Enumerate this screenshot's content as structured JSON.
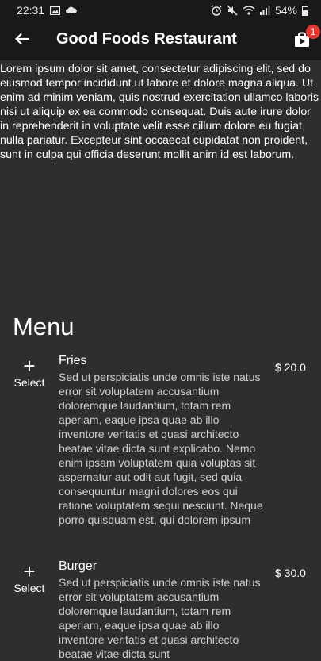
{
  "status_bar": {
    "time": "22:31",
    "battery": "54%",
    "icons": [
      "gallery-icon",
      "cloud-icon",
      "alarm-icon",
      "mute-icon",
      "wifi-icon",
      "signal-icon",
      "battery-icon"
    ]
  },
  "app_bar": {
    "title": "Good Foods Restaurant",
    "cart_badge": "1"
  },
  "restaurant": {
    "description": "Lorem ipsum dolor sit amet, consectetur adipiscing elit, sed do eiusmod tempor incididunt ut labore et dolore magna aliqua. Ut enim ad minim veniam, quis nostrud exercitation ullamco laboris nisi ut aliquip ex ea commodo consequat. Duis aute irure dolor in reprehenderit in voluptate velit esse cillum dolore eu fugiat nulla pariatur. Excepteur sint occaecat cupidatat non proident, sunt in culpa qui officia deserunt mollit anim id est laborum."
  },
  "menu": {
    "heading": "Menu",
    "items": [
      {
        "select_label": "Select",
        "name": "Fries",
        "description": "Sed ut perspiciatis unde omnis iste natus error sit voluptatem accusantium doloremque laudantium, totam rem aperiam, eaque ipsa quae ab illo inventore veritatis et quasi architecto beatae vitae dicta sunt explicabo. Nemo enim ipsam voluptatem quia voluptas sit aspernatur aut odit aut fugit, sed quia consequuntur magni dolores eos qui ratione voluptatem sequi nesciunt. Neque porro quisquam est, qui dolorem ipsum",
        "price": "$ 20.0"
      },
      {
        "select_label": "Select",
        "name": "Burger",
        "description": "Sed ut perspiciatis unde omnis iste natus error sit voluptatem accusantium doloremque laudantium, totam rem aperiam, eaque ipsa quae ab illo inventore veritatis et quasi architecto beatae vitae dicta sunt",
        "price": "$ 30.0"
      }
    ]
  },
  "colors": {
    "background": "#2e2e2e",
    "app_bar": "#191919",
    "badge": "#e53935",
    "description_text": "#cfcfcf"
  }
}
